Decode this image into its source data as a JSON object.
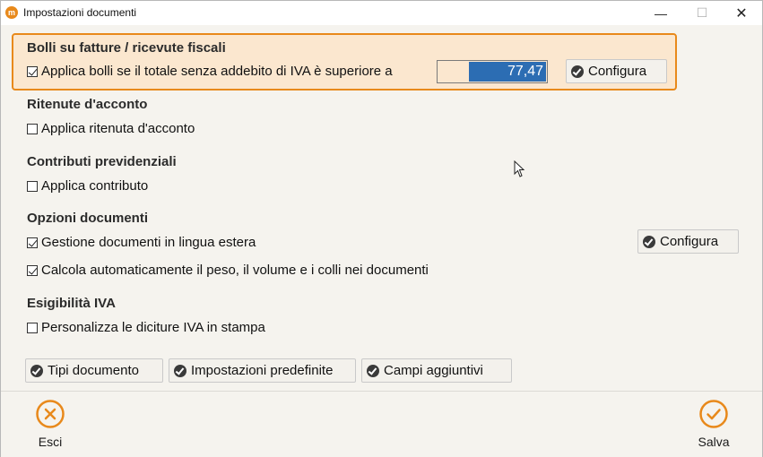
{
  "window": {
    "title": "Impostazioni documenti",
    "app_icon_glyph": "m",
    "controls": {
      "minimize": "—",
      "maximize": "☐",
      "close": "✕"
    }
  },
  "bolli": {
    "title": "Bolli su fatture / ricevute fiscali",
    "checkbox_label": "Applica bolli se il totale senza addebito di IVA è superiore a",
    "checked": true,
    "amount": "77,47",
    "configure_label": "Configura"
  },
  "ritenute": {
    "title": "Ritenute d'acconto",
    "checkbox_label": "Applica ritenuta d'acconto",
    "checked": false
  },
  "contributi": {
    "title": "Contributi previdenziali",
    "checkbox_label": "Applica contributo",
    "checked": false
  },
  "opzioni": {
    "title": "Opzioni documenti",
    "lingua_label": "Gestione documenti in lingua estera",
    "lingua_checked": true,
    "configure_label": "Configura",
    "peso_label": "Calcola automaticamente il peso, il volume e i colli nei documenti",
    "peso_checked": true
  },
  "esigibilita": {
    "title": "Esigibilità IVA",
    "checkbox_label": "Personalizza le diciture IVA in stampa",
    "checked": false
  },
  "bottom_buttons": {
    "tipi": "Tipi documento",
    "predefinite": "Impostazioni predefinite",
    "campi": "Campi aggiuntivi"
  },
  "footer": {
    "esci_label": "Esci",
    "salva_label": "Salva"
  },
  "colors": {
    "accent": "#e8891b",
    "highlight_bg": "#fbe7cf",
    "selection": "#2c6db3"
  },
  "icons": {
    "button_icon": "check-circle-icon",
    "esci_icon": "close-circle-icon",
    "salva_icon": "check-outline-circle-icon"
  }
}
